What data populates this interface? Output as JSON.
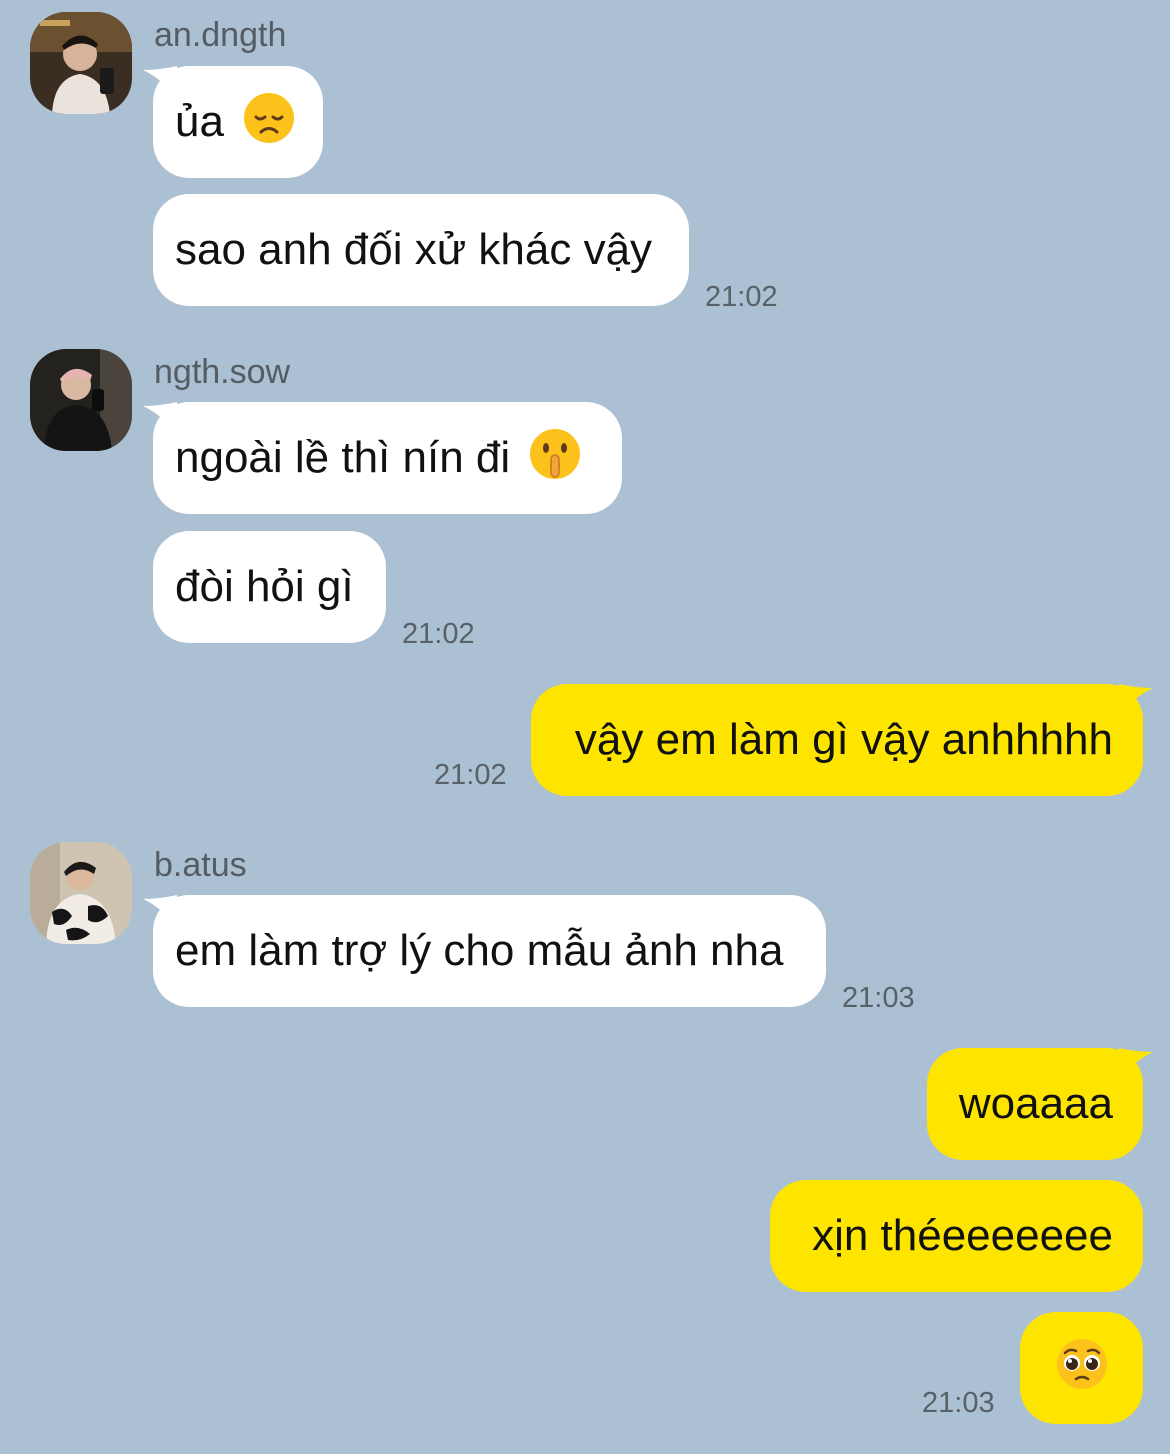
{
  "colors": {
    "background": "#abc1d3",
    "incoming_bubble": "#ffffff",
    "outgoing_bubble": "#fee500",
    "text": "#111111",
    "meta_text": "#596168"
  },
  "messages": {
    "group1": {
      "sender": "an.dngth",
      "bubble1": {
        "text": "ủa",
        "emoji": "disappointed-face-emoji"
      },
      "bubble2": {
        "text": "sao anh đối xử khác vậy"
      },
      "time": "21:02"
    },
    "group2": {
      "sender": "ngth.sow",
      "bubble1": {
        "text": "ngoài lề thì nín đi",
        "emoji": "shushing-face-emoji"
      },
      "bubble2": {
        "text": "đòi hỏi gì"
      },
      "time": "21:02"
    },
    "group3": {
      "bubble1": {
        "text": "vậy em làm gì vậy anhhhhh"
      },
      "time": "21:02"
    },
    "group4": {
      "sender": "b.atus",
      "bubble1": {
        "text": "em làm trợ lý cho mẫu ảnh nha"
      },
      "time": "21:03"
    },
    "group5": {
      "bubble1": {
        "text": "woaaaa"
      },
      "bubble2": {
        "text": "xịn théeeeeeee"
      },
      "bubble3": {
        "emoji": "pleading-face-emoji"
      },
      "time": "21:03"
    }
  }
}
